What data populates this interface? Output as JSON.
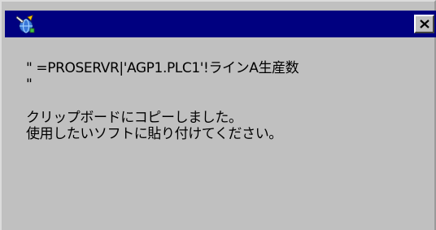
{
  "dialog": {
    "title": "",
    "close_glyph": "×",
    "icon": "app-icon",
    "message_lines": [
      "\" =PROSERVR|'AGP1.PLC1'!ラインA生産数",
      "\"",
      "クリップボードにコピーしました。",
      "使用したいソフトに貼り付けてください。"
    ]
  }
}
